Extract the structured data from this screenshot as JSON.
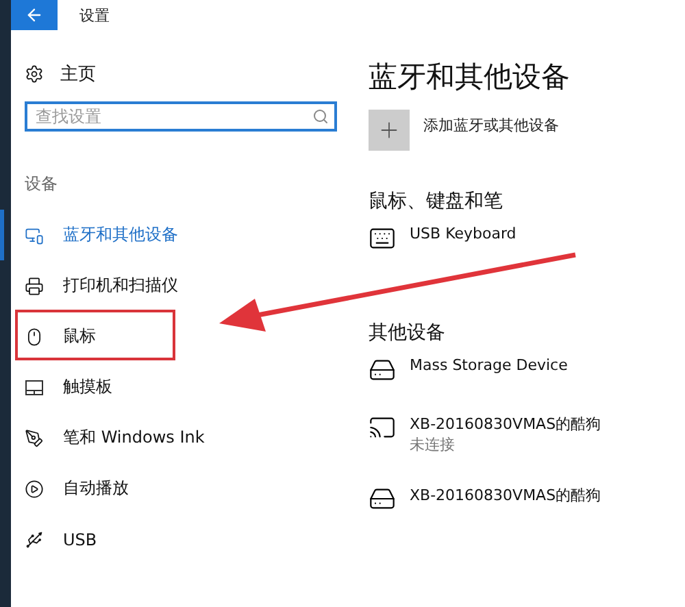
{
  "window": {
    "title": "设置"
  },
  "sidebar": {
    "home": "主页",
    "search": {
      "placeholder": "查找设置"
    },
    "section": "设备",
    "items": [
      {
        "label": "蓝牙和其他设备",
        "kind": "devices",
        "selected": true,
        "highlighted": false
      },
      {
        "label": "打印机和扫描仪",
        "kind": "printer",
        "selected": false,
        "highlighted": false
      },
      {
        "label": "鼠标",
        "kind": "mouse",
        "selected": false,
        "highlighted": true
      },
      {
        "label": "触摸板",
        "kind": "touchpad",
        "selected": false,
        "highlighted": false
      },
      {
        "label": "笔和 Windows Ink",
        "kind": "pen",
        "selected": false,
        "highlighted": false
      },
      {
        "label": "自动播放",
        "kind": "autoplay",
        "selected": false,
        "highlighted": false
      },
      {
        "label": "USB",
        "kind": "usb",
        "selected": false,
        "highlighted": false
      }
    ]
  },
  "content": {
    "title": "蓝牙和其他设备",
    "add_button": "添加蓝牙或其他设备",
    "groups": [
      {
        "heading": "鼠标、键盘和笔",
        "devices": [
          {
            "name": "USB Keyboard",
            "kind": "keyboard"
          }
        ]
      },
      {
        "heading": "其他设备",
        "devices": [
          {
            "name": "Mass Storage Device",
            "kind": "drive"
          },
          {
            "name": "XB-20160830VMAS的酷狗",
            "status": "未连接",
            "kind": "cast"
          },
          {
            "name": "XB-20160830VMAS的酷狗",
            "kind": "drive"
          }
        ]
      }
    ]
  }
}
